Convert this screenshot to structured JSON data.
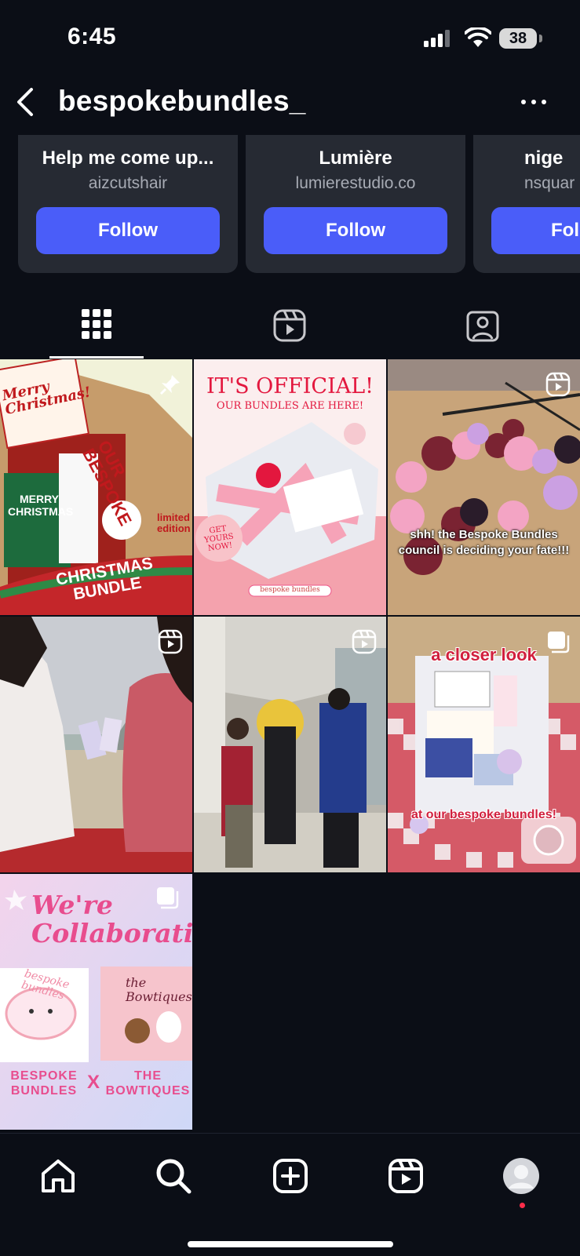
{
  "status_bar": {
    "time": "6:45",
    "battery": "38"
  },
  "header": {
    "username": "bespokebundles_"
  },
  "suggestions": [
    {
      "name": "Help me come up...",
      "handle": "aizcutshair",
      "button": "Follow"
    },
    {
      "name": "Lumière",
      "handle": "lumierestudio.co",
      "button": "Follow"
    },
    {
      "name": "nige",
      "handle": "nsquar",
      "button": "Fol"
    }
  ],
  "posts": [
    {
      "type": "image",
      "text": [
        "Merry Christmas!",
        "MERRY CHRISTMAS",
        "OUR BESPOKE",
        "limited edition",
        "CHRISTMAS BUNDLE"
      ]
    },
    {
      "type": "image",
      "text": [
        "IT'S OFFICIAL!",
        "OUR BUNDLES ARE HERE!",
        "GET YOURS NOW!",
        "bespoke bundles"
      ]
    },
    {
      "type": "reel",
      "text": [
        "shh! the Bespoke Bundles council is deciding your fate!!!"
      ]
    },
    {
      "type": "reel",
      "text": []
    },
    {
      "type": "reel",
      "text": []
    },
    {
      "type": "carousel",
      "text": [
        "a closer look",
        "at our bespoke bundles!"
      ]
    },
    {
      "type": "carousel",
      "text": [
        "We're Collaborating!",
        "bespoke bundles",
        "the Bowtiques",
        "BESPOKE BUNDLES",
        "X",
        "THE BOWTIQUES"
      ]
    }
  ],
  "colors": {
    "accent": "#4a5df9",
    "background": "#0b0e16",
    "card": "#262a33",
    "notification": "#ff2d4a"
  },
  "icons": {
    "tabs": [
      "grid-icon",
      "reels-icon",
      "tagged-icon"
    ],
    "nav": [
      "home-icon",
      "search-icon",
      "create-icon",
      "reels-icon",
      "profile-avatar"
    ]
  }
}
